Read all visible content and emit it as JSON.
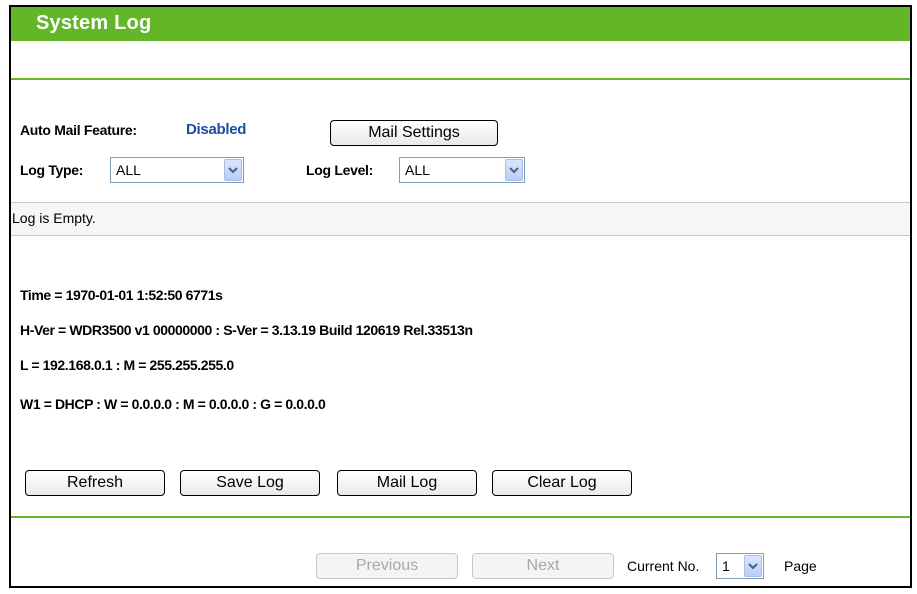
{
  "title": "System Log",
  "auto_mail": {
    "label": "Auto Mail Feature:",
    "status": "Disabled",
    "button": "Mail Settings"
  },
  "log_type": {
    "label": "Log Type:",
    "value": "ALL"
  },
  "log_level": {
    "label": "Log Level:",
    "value": "ALL"
  },
  "log_content": "Log is Empty.",
  "info": {
    "time": "Time = 1970-01-01 1:52:50 6771s",
    "version": "H-Ver = WDR3500 v1 00000000 : S-Ver = 3.13.19 Build 120619 Rel.33513n",
    "lan": "L = 192.168.0.1 : M = 255.255.255.0",
    "wan": "W1 = DHCP : W = 0.0.0.0 : M = 0.0.0.0 : G = 0.0.0.0"
  },
  "actions": {
    "refresh": "Refresh",
    "save": "Save Log",
    "mail": "Mail Log",
    "clear": "Clear Log"
  },
  "pager": {
    "previous": "Previous",
    "next": "Next",
    "current_label": "Current No.",
    "current_value": "1",
    "page_label": "Page"
  },
  "colors": {
    "accent": "#63b627",
    "status_blue": "#1b4da3"
  }
}
